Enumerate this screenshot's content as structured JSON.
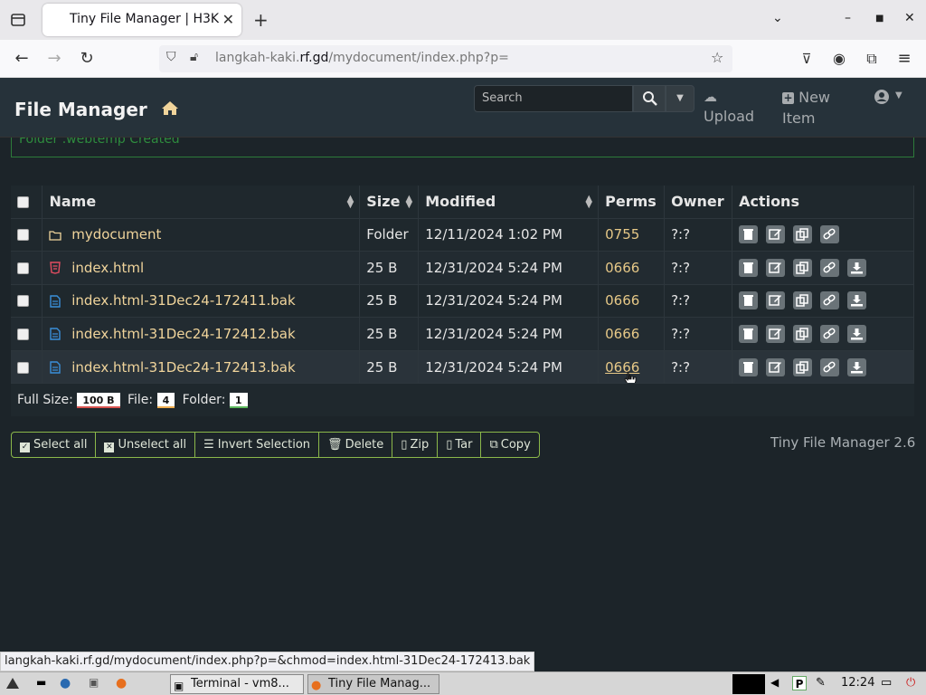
{
  "browser": {
    "tab_title": "Tiny File Manager | H3K",
    "url_host": "langkah-kaki.",
    "url_domain": "rf.gd",
    "url_path": "/mydocument/index.php?p="
  },
  "app": {
    "brand": "File Manager",
    "search_placeholder": "Search",
    "upload_label": "Upload",
    "new_item_label_1": "New",
    "new_item_label_2": "Item"
  },
  "flash": {
    "message": "Folder .webtemp Created"
  },
  "table": {
    "headers": {
      "name": "Name",
      "size": "Size",
      "modified": "Modified",
      "perms": "Perms",
      "owner": "Owner",
      "actions": "Actions"
    },
    "rows": [
      {
        "name": "mydocument",
        "size": "Folder",
        "modified": "12/11/2024 1:02 PM",
        "perms": "0755",
        "owner": "?:?"
      },
      {
        "name": "index.html",
        "size": "25 B",
        "modified": "12/31/2024 5:24 PM",
        "perms": "0666",
        "owner": "?:?"
      },
      {
        "name": "index.html-31Dec24-172411.bak",
        "size": "25 B",
        "modified": "12/31/2024 5:24 PM",
        "perms": "0666",
        "owner": "?:?"
      },
      {
        "name": "index.html-31Dec24-172412.bak",
        "size": "25 B",
        "modified": "12/31/2024 5:24 PM",
        "perms": "0666",
        "owner": "?:?"
      },
      {
        "name": "index.html-31Dec24-172413.bak",
        "size": "25 B",
        "modified": "12/31/2024 5:24 PM",
        "perms": "0666",
        "owner": "?:?"
      }
    ]
  },
  "summary": {
    "full_size_label": "Full Size:",
    "full_size_value": "100 B",
    "file_label": "File:",
    "file_value": "4",
    "folder_label": "Folder:",
    "folder_value": "1"
  },
  "buttons": {
    "select_all": "Select all",
    "unselect_all": "Unselect all",
    "invert_selection": "Invert Selection",
    "delete": "Delete",
    "zip": "Zip",
    "tar": "Tar",
    "copy": "Copy"
  },
  "version": "Tiny File Manager 2.6",
  "status_url": "langkah-kaki.rf.gd/mydocument/index.php?p=&chmod=index.html-31Dec24-172413.bak",
  "taskbar": {
    "terminal": "Terminal - vm8...",
    "firefox": "Tiny File Manag...",
    "clock": "12:24"
  },
  "colors": {
    "header_bg": "#26323a",
    "page_bg": "#1c2429",
    "accent_green": "#8bb84a",
    "file_name": "#f0d49b"
  }
}
